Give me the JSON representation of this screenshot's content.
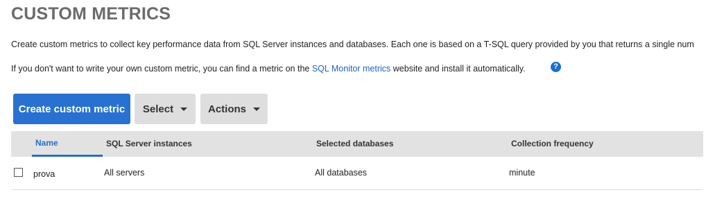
{
  "page": {
    "title": "CUSTOM METRICS",
    "intro": "Create custom metrics to collect key performance data from SQL Server instances and databases. Each one is based on a T-SQL query provided by you that returns a single num",
    "intro2_before": "If you don't want to write your own custom metric, you can find a metric on the ",
    "intro2_link": "SQL Monitor metrics",
    "intro2_after": " website and install it automatically.",
    "help_icon_glyph": "?"
  },
  "toolbar": {
    "create_label": "Create custom metric",
    "select_label": "Select",
    "actions_label": "Actions"
  },
  "table": {
    "headers": {
      "name": "Name",
      "instances": "SQL Server instances",
      "databases": "Selected databases",
      "frequency": "Collection frequency"
    },
    "rows": [
      {
        "checked": false,
        "name": "prova",
        "instances": "All servers",
        "databases": "All databases",
        "frequency": "minute"
      }
    ]
  },
  "colors": {
    "primary": "#2871d1",
    "link": "#1a64c4",
    "header_bg": "#e2e2e2",
    "title": "#6b6b6b"
  }
}
